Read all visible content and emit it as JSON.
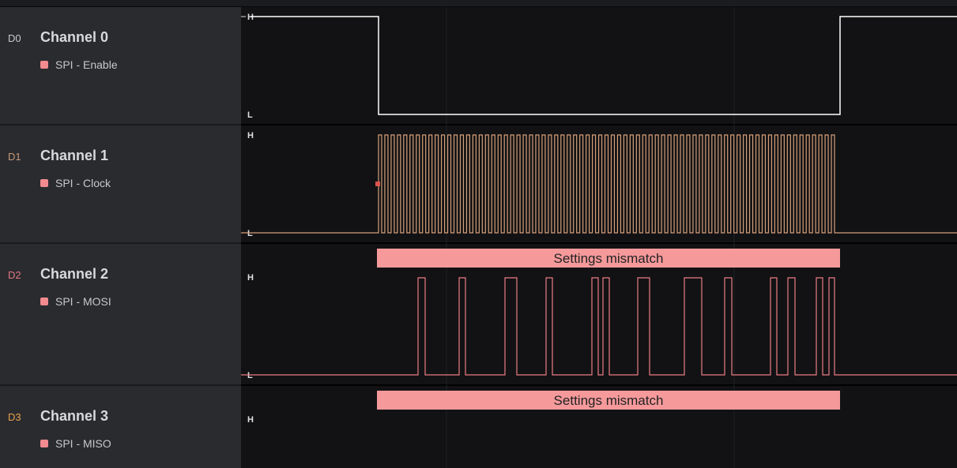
{
  "channels": [
    {
      "id": "D0",
      "name": "Channel 0",
      "sub": "SPI - Enable",
      "id_color": "#c9c9cd",
      "wave_color": "#ffffff"
    },
    {
      "id": "D1",
      "name": "Channel 1",
      "sub": "SPI - Clock",
      "id_color": "#c79a7a",
      "wave_color": "#d6a07a"
    },
    {
      "id": "D2",
      "name": "Channel 2",
      "sub": "SPI - MOSI",
      "id_color": "#e07880",
      "wave_color": "#ea7d85"
    },
    {
      "id": "D3",
      "name": "Channel 3",
      "sub": "SPI - MISO",
      "id_color": "#e8a24a",
      "wave_color": "#e8a24a"
    }
  ],
  "levels": {
    "high": "H",
    "low": "L"
  },
  "annotations": {
    "mosi": "Settings mismatch",
    "miso": "Settings mismatch"
  },
  "colors": {
    "annotation_fill": "#f5999b",
    "background": "#121214",
    "sidebar": "#2a2b2f",
    "marker": "#d9534f"
  }
}
